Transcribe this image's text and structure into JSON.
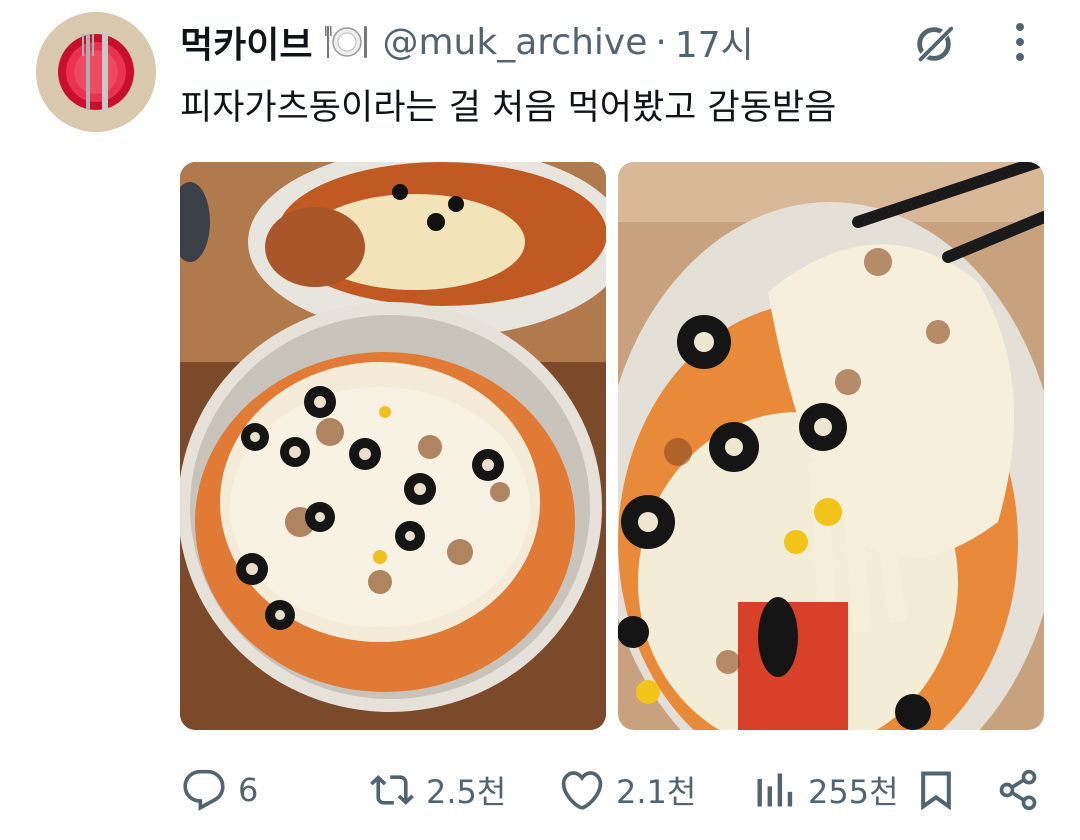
{
  "tweet": {
    "author_name": "먹카이브",
    "author_emoji": "plate-with-cutlery-icon",
    "handle": "@muk_archive",
    "separator": "·",
    "time": "17시",
    "text": "피자가츠동이라는 걸 처음 먹어봤고 감동받음",
    "images": [
      "pizza-katsudon-bowls-photo",
      "pizza-katsudon-cheese-pull-photo"
    ]
  },
  "actions": {
    "replies": "6",
    "reposts": "2.5천",
    "likes": "2.1천",
    "views": "255천"
  },
  "colors": {
    "text_primary": "#0f1419",
    "text_secondary": "#536471",
    "avatar_bg": "#d8c8ae",
    "avatar_plate": "#d81e3a"
  }
}
